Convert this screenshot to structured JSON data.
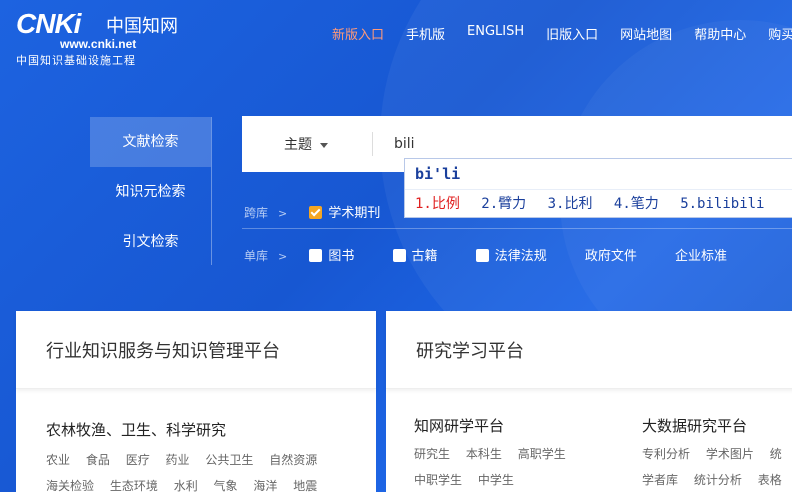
{
  "header": {
    "logo_mark": "CNKi",
    "logo_cn": "中国知网",
    "logo_url": "www.cnki.net",
    "tagline": "中国知识基础设施工程",
    "nav": [
      "新版入口",
      "手机版",
      "ENGLISH",
      "旧版入口",
      "网站地图",
      "帮助中心",
      "购买"
    ],
    "active_color": "#ff9a7a"
  },
  "left_tabs": [
    "文献检索",
    "知识元检索",
    "引文检索"
  ],
  "search": {
    "field": "主题",
    "value": "bili"
  },
  "ime": {
    "compose": "bi'li",
    "candidates": [
      "1.比例",
      "2.臂力",
      "3.比利",
      "4.笔力",
      "5.bilibili"
    ]
  },
  "cross_db": {
    "label": "跨库",
    "options": [
      {
        "label": "学术期刊",
        "checked": true
      }
    ]
  },
  "single_db": {
    "label": "单库",
    "options": [
      {
        "label": "图书",
        "checkbox": true
      },
      {
        "label": "古籍",
        "checkbox": true
      },
      {
        "label": "法律法规",
        "checkbox": true
      },
      {
        "label": "政府文件",
        "checkbox": false
      },
      {
        "label": "企业标准",
        "checkbox": false
      }
    ]
  },
  "cards": {
    "left": {
      "title": "行业知识服务与知识管理平台",
      "subtitle": "农林牧渔、卫生、科学研究",
      "row1": [
        "农业",
        "食品",
        "医疗",
        "药业",
        "公共卫生",
        "自然资源"
      ],
      "row2": [
        "海关检验",
        "生态环境",
        "水利",
        "气象",
        "海洋",
        "地震"
      ]
    },
    "right": {
      "title": "研究学习平台",
      "col1_title": "知网研学平台",
      "col1_row1": [
        "研究生",
        "本科生",
        "高职学生"
      ],
      "col1_row2": [
        "中职学生",
        "中学生"
      ],
      "col2_title": "大数据研究平台",
      "col2_row1": [
        "专利分析",
        "学术图片",
        "统"
      ],
      "col2_row2": [
        "学者库",
        "统计分析",
        "表格"
      ]
    }
  },
  "colors": {
    "background": "#1a5cd8",
    "checkbox_on": "#f5a623",
    "ime_first": "#e02020"
  }
}
